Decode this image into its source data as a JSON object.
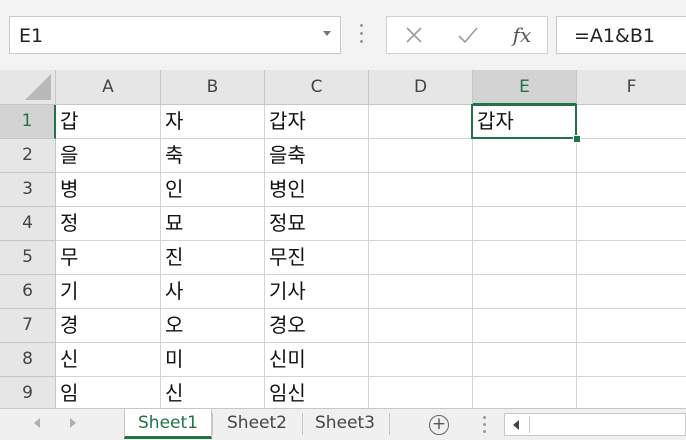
{
  "formula_bar": {
    "name_box": "E1",
    "cancel_icon": "close-icon",
    "enter_icon": "check-icon",
    "fx_label": "fx",
    "formula": "=A1&B1"
  },
  "columns": [
    "A",
    "B",
    "C",
    "D",
    "E",
    "F"
  ],
  "selected_column": "E",
  "rows": [
    {
      "num": "1",
      "cells": [
        "갑",
        "자",
        "갑자",
        "",
        "갑자",
        ""
      ]
    },
    {
      "num": "2",
      "cells": [
        "을",
        "축",
        "을축",
        "",
        "",
        ""
      ]
    },
    {
      "num": "3",
      "cells": [
        "병",
        "인",
        "병인",
        "",
        "",
        ""
      ]
    },
    {
      "num": "4",
      "cells": [
        "정",
        "묘",
        "정묘",
        "",
        "",
        ""
      ]
    },
    {
      "num": "5",
      "cells": [
        "무",
        "진",
        "무진",
        "",
        "",
        ""
      ]
    },
    {
      "num": "6",
      "cells": [
        "기",
        "사",
        "기사",
        "",
        "",
        ""
      ]
    },
    {
      "num": "7",
      "cells": [
        "경",
        "오",
        "경오",
        "",
        "",
        ""
      ]
    },
    {
      "num": "8",
      "cells": [
        "신",
        "미",
        "신미",
        "",
        "",
        ""
      ]
    },
    {
      "num": "9",
      "cells": [
        "임",
        "신",
        "임신",
        "",
        "",
        ""
      ]
    }
  ],
  "selected_row": "1",
  "sheets": {
    "tabs": [
      "Sheet1",
      "Sheet2",
      "Sheet3"
    ],
    "active": "Sheet1",
    "add_label": "+"
  },
  "colors": {
    "accent": "#217346",
    "header_bg": "#e6e6e6",
    "gridline": "#d4d4d4"
  }
}
